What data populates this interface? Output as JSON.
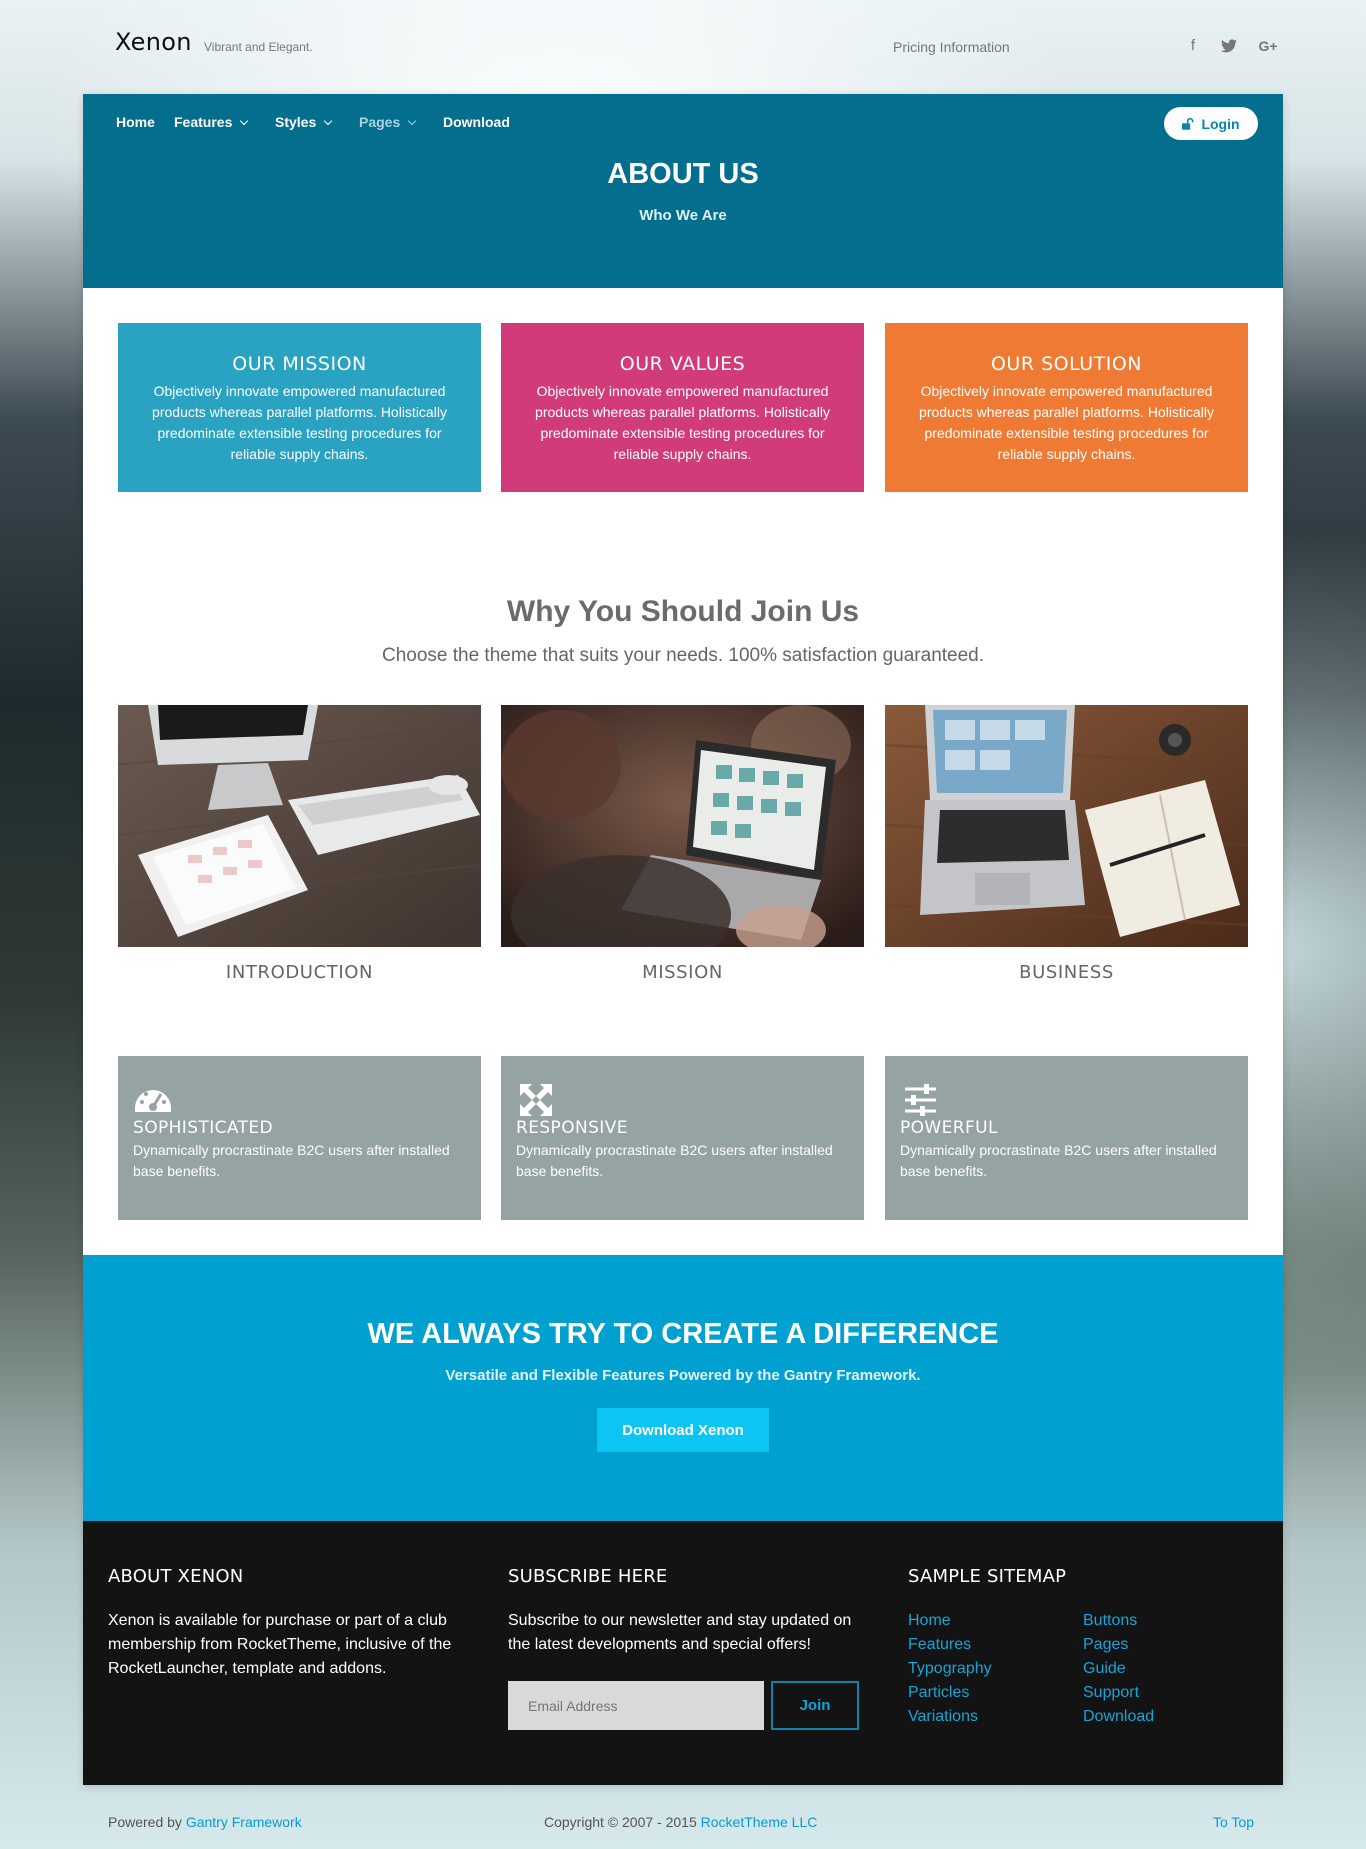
{
  "header": {
    "brand": "Xenon",
    "tagline": "Vibrant and Elegant.",
    "pricing_link": "Pricing Information",
    "social": [
      {
        "icon": "facebook-icon",
        "glyph": "f"
      },
      {
        "icon": "twitter-icon",
        "glyph": "t"
      },
      {
        "icon": "google-plus-icon",
        "glyph": "G+"
      }
    ]
  },
  "nav": {
    "items": [
      {
        "label": "Home",
        "dropdown": false
      },
      {
        "label": "Features",
        "dropdown": true
      },
      {
        "label": "Styles",
        "dropdown": true
      },
      {
        "label": "Pages",
        "dropdown": true
      },
      {
        "label": "Download",
        "dropdown": false
      }
    ],
    "login_label": "Login"
  },
  "hero": {
    "title": "ABOUT US",
    "subtitle": "Who We Are"
  },
  "values": [
    {
      "title": "OUR MISSION",
      "text": "Objectively innovate empowered manufactured products whereas parallel platforms. Holistically predominate extensible testing procedures for reliable supply chains.",
      "color": "#2aa3c3"
    },
    {
      "title": "OUR VALUES",
      "text": "Objectively innovate empowered manufactured products whereas parallel platforms. Holistically predominate extensible testing procedures for reliable supply chains.",
      "color": "#d23b7a"
    },
    {
      "title": "OUR SOLUTION",
      "text": "Objectively innovate empowered manufactured products whereas parallel platforms. Holistically predominate extensible testing procedures for reliable supply chains.",
      "color": "#ef7a33"
    }
  ],
  "why": {
    "title": "Why You Should Join Us",
    "subtitle": "Choose the theme that suits your needs. 100% satisfaction guaranteed.",
    "photos": [
      {
        "caption": "INTRODUCTION"
      },
      {
        "caption": "MISSION"
      },
      {
        "caption": "BUSINESS"
      }
    ]
  },
  "features": [
    {
      "icon": "dashboard-icon",
      "title": "SOPHISTICATED",
      "text": "Dynamically procrastinate B2C users after installed base benefits."
    },
    {
      "icon": "expand-arrows-icon",
      "title": "RESPONSIVE",
      "text": "Dynamically procrastinate B2C users after installed base benefits."
    },
    {
      "icon": "sliders-icon",
      "title": "POWERFUL",
      "text": "Dynamically procrastinate B2C users after installed base benefits."
    }
  ],
  "cta": {
    "title": "WE ALWAYS TRY TO CREATE A DIFFERENCE",
    "subtitle": "Versatile and Flexible Features Powered by the Gantry Framework.",
    "button": "Download Xenon"
  },
  "footer": {
    "about_title": "ABOUT XENON",
    "about_text": "Xenon is available for purchase or part of a club membership from RocketTheme, inclusive of the RocketLauncher, template and addons.",
    "subscribe_title": "SUBSCRIBE HERE",
    "subscribe_text": "Subscribe to our newsletter and stay updated on the latest developments and special offers!",
    "email_placeholder": "Email Address",
    "join_label": "Join",
    "sitemap_title": "SAMPLE SITEMAP",
    "sitemap_col1": [
      "Home",
      "Features",
      "Typography",
      "Particles",
      "Variations"
    ],
    "sitemap_col2": [
      "Buttons",
      "Pages",
      "Guide",
      "Support",
      "Download"
    ]
  },
  "bottom": {
    "powered_prefix": "Powered by",
    "powered_link": "Gantry Framework",
    "copyright_prefix": "Copyright © 2007 - 2015",
    "copyright_link": "RocketTheme LLC",
    "to_top": "To Top"
  },
  "colors": {
    "hero": "#036e8d",
    "cta": "#00a1d1",
    "feature_box": "#95a3a2",
    "footer": "#131313",
    "link": "#16a5d6"
  }
}
